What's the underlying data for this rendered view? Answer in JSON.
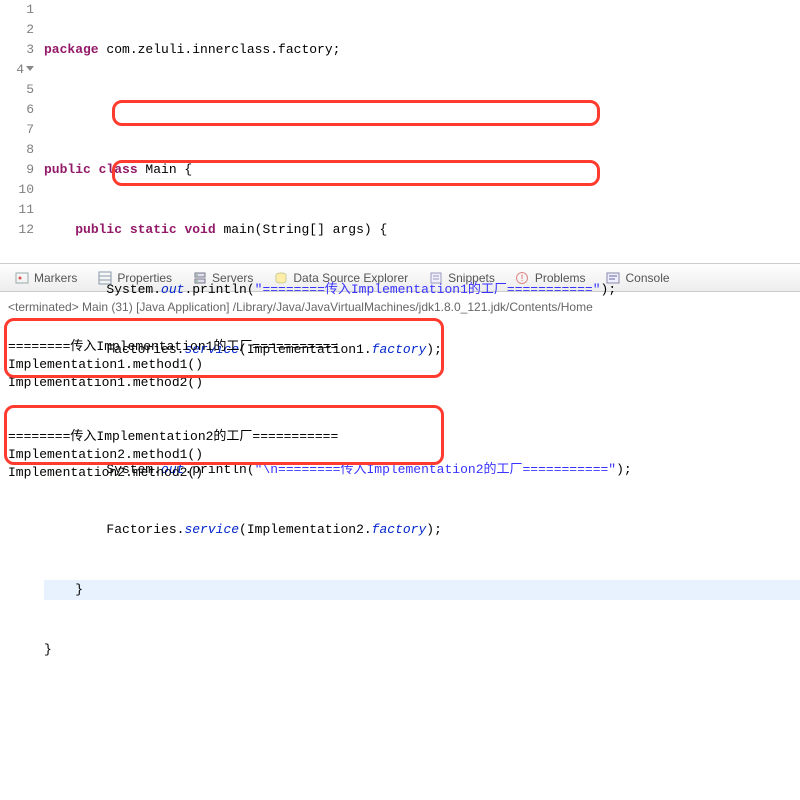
{
  "editor": {
    "lines": {
      "l1_package": "package",
      "l1_pkg": " com.zeluli.innerclass.factory;",
      "l3_public": "public",
      "l3_class": " class",
      "l3_name": " Main {",
      "l4_public": "public",
      "l4_static": " static",
      "l4_void": " void",
      "l4_main": " main(String[] args) {",
      "l5_sysout": "System.",
      "l5_out": "out",
      "l5_println": ".println(",
      "l5_str": "\"========传入Implementation1的工厂===========\"",
      "l5_end": ");",
      "l6_call": "Factories.",
      "l6_service": "service",
      "l6_paren": "(Implementation1.",
      "l6_factory": "factory",
      "l6_end": ");",
      "l8_sysout": "System.",
      "l8_out": "out",
      "l8_println": ".println(",
      "l8_str": "\"\\n========传入Implementation2的工厂===========\"",
      "l8_end": ");",
      "l9_call": "Factories.",
      "l9_service": "service",
      "l9_paren": "(Implementation2.",
      "l9_factory": "factory",
      "l9_end": ");",
      "l10": "}",
      "l11": "}"
    },
    "gutter": [
      "1",
      "2",
      "3",
      "4",
      "5",
      "6",
      "7",
      "8",
      "9",
      "10",
      "11",
      "12"
    ]
  },
  "tabs": {
    "markers": "Markers",
    "properties": "Properties",
    "servers": "Servers",
    "dse": "Data Source Explorer",
    "snippets": "Snippets",
    "problems": "Problems",
    "console": "Console"
  },
  "console": {
    "header": "<terminated> Main (31) [Java Application] /Library/Java/JavaVirtualMachines/jdk1.8.0_121.jdk/Contents/Home",
    "out1_a": "========传入Implementation1的工厂===========",
    "out1_b": "Implementation1.method1()",
    "out1_c": "Implementation1.method2()",
    "blank": "",
    "out2_a": "========传入Implementation2的工厂===========",
    "out2_b": "Implementation2.method1()",
    "out2_c": "Implementation2.method2()"
  }
}
